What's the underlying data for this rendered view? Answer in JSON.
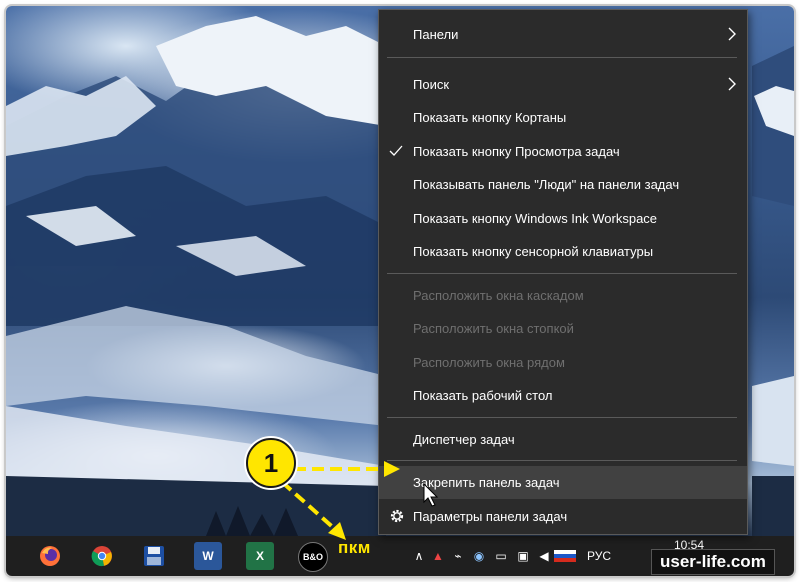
{
  "context_menu": {
    "items": [
      {
        "label": "Панели",
        "submenu": true
      },
      {
        "label": "Поиск",
        "submenu": true
      },
      {
        "label": "Показать кнопку Кортаны"
      },
      {
        "label": "Показать кнопку Просмотра задач",
        "checked": true
      },
      {
        "label": "Показывать панель \"Люди\" на панели задач"
      },
      {
        "label": "Показать кнопку Windows Ink Workspace"
      },
      {
        "label": "Показать кнопку сенсорной клавиатуры"
      },
      {
        "label": "Расположить окна каскадом",
        "disabled": true
      },
      {
        "label": "Расположить окна стопкой",
        "disabled": true
      },
      {
        "label": "Расположить окна рядом",
        "disabled": true
      },
      {
        "label": "Показать рабочий стол"
      },
      {
        "label": "Диспетчер задач"
      },
      {
        "label": "Закрепить панель задач",
        "highlighted": true
      },
      {
        "label": "Параметры панели задач",
        "icon": "gear-icon"
      }
    ]
  },
  "taskbar": {
    "apps": [
      {
        "name": "firefox-icon"
      },
      {
        "name": "chrome-icon"
      },
      {
        "name": "save-disk-icon"
      },
      {
        "name": "word-icon",
        "text": "W"
      },
      {
        "name": "excel-icon",
        "text": "X"
      },
      {
        "name": "bo-app-icon",
        "text": "B&O"
      }
    ],
    "tray": {
      "language": "РУС",
      "time": "10:54"
    }
  },
  "annotation": {
    "step_number": "1",
    "mouse_label": "пкм",
    "accent_color": "#ffe600"
  },
  "watermark": "user-life.com"
}
